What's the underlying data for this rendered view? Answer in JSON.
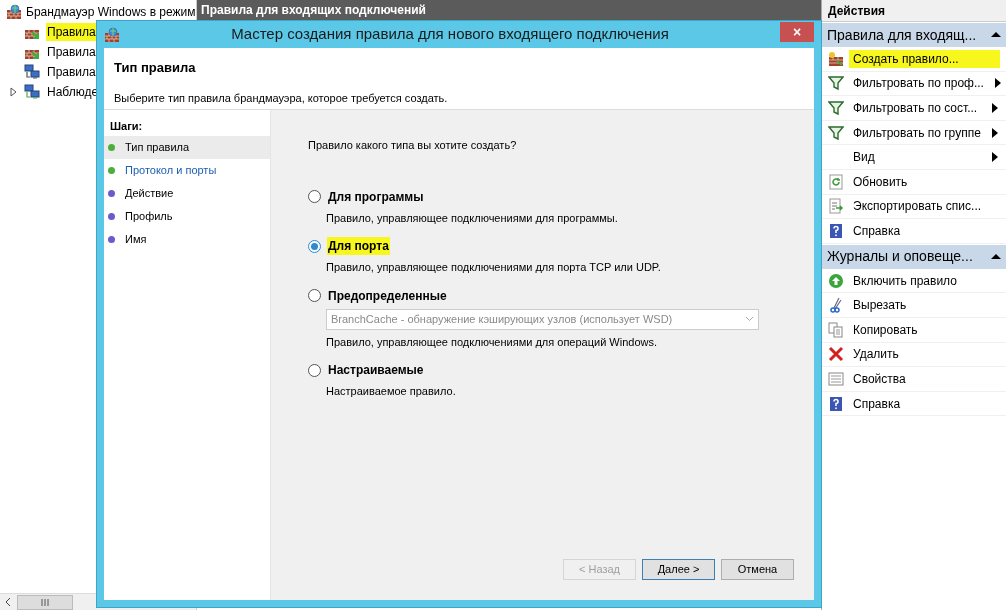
{
  "tree": {
    "root": {
      "label": "Брандмауэр Windows в режим"
    },
    "children": [
      {
        "label": "Правила",
        "kind": "inbound",
        "highlighted": true,
        "expandable": false
      },
      {
        "label": "Правила",
        "kind": "outbound",
        "highlighted": false,
        "expandable": false
      },
      {
        "label": "Правила",
        "kind": "security",
        "highlighted": false,
        "expandable": false
      },
      {
        "label": "Наблюде",
        "kind": "monitor",
        "highlighted": false,
        "expandable": true
      }
    ]
  },
  "center_header": "Правила для входящих подключений",
  "dialog": {
    "title": "Мастер создания правила для нового входящего подключения",
    "close": "×",
    "heading": "Тип правила",
    "subtitle": "Выберите тип правила брандмауэра, которое требуется создать.",
    "steps_title": "Шаги:",
    "steps": [
      {
        "label": "Тип правила",
        "selected": true,
        "link": false,
        "color": "#4caf3a"
      },
      {
        "label": "Протокол и порты",
        "selected": false,
        "link": true,
        "color": "#4caf3a"
      },
      {
        "label": "Действие",
        "selected": false,
        "link": false,
        "color": "#6a5acd"
      },
      {
        "label": "Профиль",
        "selected": false,
        "link": false,
        "color": "#6a5acd"
      },
      {
        "label": "Имя",
        "selected": false,
        "link": false,
        "color": "#6a5acd"
      }
    ],
    "question": "Правило какого типа вы хотите создать?",
    "options": [
      {
        "label": "Для программы",
        "description": "Правило, управляющее подключениями для программы.",
        "selected": false,
        "highlighted": false
      },
      {
        "label": "Для порта",
        "description": "Правило, управляющее подключениями для порта TCP или UDP.",
        "selected": true,
        "highlighted": true
      },
      {
        "label": "Предопределенные",
        "dropdown": {
          "value": "BranchCache - обнаружение кэширующих узлов (использует WSD)",
          "disabled": true
        },
        "description": "Правило, управляющее подключениями для операций Windows.",
        "selected": false,
        "highlighted": false
      },
      {
        "label": "Настраиваемые",
        "description": "Настраиваемое правило.",
        "selected": false,
        "highlighted": false
      }
    ],
    "buttons": [
      {
        "label": "< Назад",
        "disabled": true,
        "default": false
      },
      {
        "label": "Далее >",
        "disabled": false,
        "default": true
      },
      {
        "label": "Отмена",
        "disabled": false,
        "default": false
      }
    ]
  },
  "actions": {
    "title": "Действия",
    "sections": [
      {
        "title": "Правила для входящ...",
        "expanded": true,
        "items": [
          {
            "label": "Создать правило...",
            "kind": "new-rule",
            "submenu": false,
            "highlighted": true
          },
          {
            "label": "Фильтровать по проф...",
            "kind": "filter",
            "submenu": true,
            "highlighted": false
          },
          {
            "label": "Фильтровать по сост...",
            "kind": "filter",
            "submenu": true,
            "highlighted": false
          },
          {
            "label": "Фильтровать по группе",
            "kind": "filter",
            "submenu": true,
            "highlighted": false
          },
          {
            "label": "Вид",
            "kind": "none",
            "submenu": true,
            "highlighted": false
          },
          {
            "label": "Обновить",
            "kind": "refresh",
            "submenu": false,
            "highlighted": false
          },
          {
            "label": "Экспортировать спис...",
            "kind": "export",
            "submenu": false,
            "highlighted": false
          },
          {
            "label": "Справка",
            "kind": "help",
            "submenu": false,
            "highlighted": false
          }
        ]
      },
      {
        "title": "Журналы и оповеще...",
        "expanded": true,
        "items": [
          {
            "label": "Включить правило",
            "kind": "enable",
            "submenu": false,
            "highlighted": false
          },
          {
            "label": "Вырезать",
            "kind": "cut",
            "submenu": false,
            "highlighted": false
          },
          {
            "label": "Копировать",
            "kind": "copy",
            "submenu": false,
            "highlighted": false
          },
          {
            "label": "Удалить",
            "kind": "delete",
            "submenu": false,
            "highlighted": false
          },
          {
            "label": "Свойства",
            "kind": "properties",
            "submenu": false,
            "highlighted": false
          },
          {
            "label": "Справка",
            "kind": "help",
            "submenu": false,
            "highlighted": false
          }
        ]
      }
    ]
  }
}
